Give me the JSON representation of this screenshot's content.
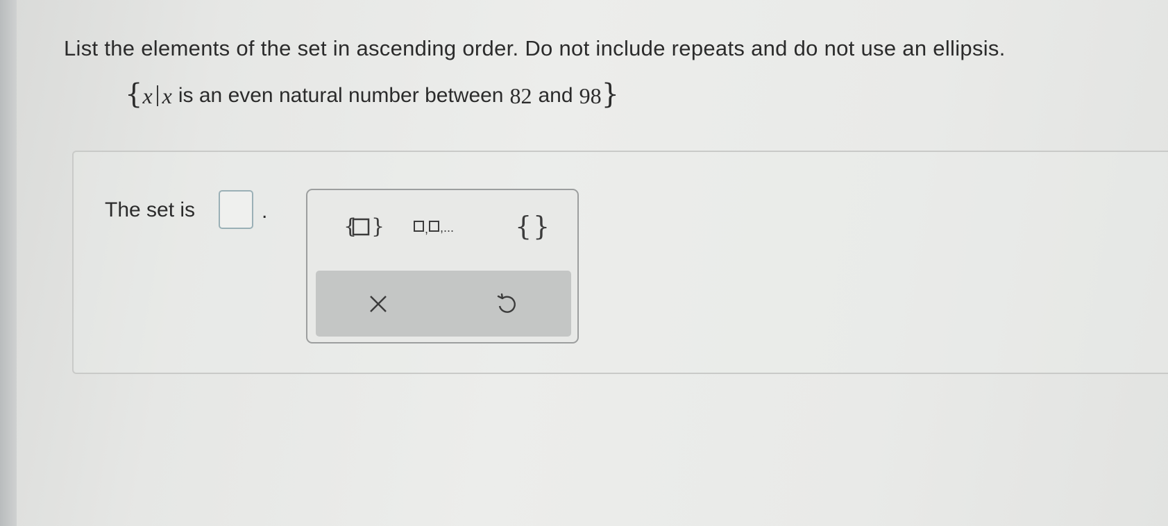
{
  "question": {
    "instruction": "List the elements of the set in ascending order. Do not include repeats and do not use an ellipsis.",
    "set_builder": {
      "open_brace": "{",
      "variable": "x",
      "variable_again": "x",
      "text_before": "is an even natural number between",
      "lower": "82",
      "text_middle": "and",
      "upper": "98",
      "close_brace": "}"
    }
  },
  "answer": {
    "label": "The set is",
    "value": "",
    "period": "."
  },
  "palette": {
    "tools": [
      {
        "name": "set-with-box",
        "icon": "set-braces-box-icon"
      },
      {
        "name": "list-with-ellipsis",
        "icon": "list-ellipsis-icon"
      },
      {
        "name": "empty-set",
        "icon": "empty-braces-icon"
      }
    ],
    "actions": [
      {
        "name": "clear",
        "icon": "close-icon"
      },
      {
        "name": "undo",
        "icon": "undo-icon"
      }
    ]
  }
}
